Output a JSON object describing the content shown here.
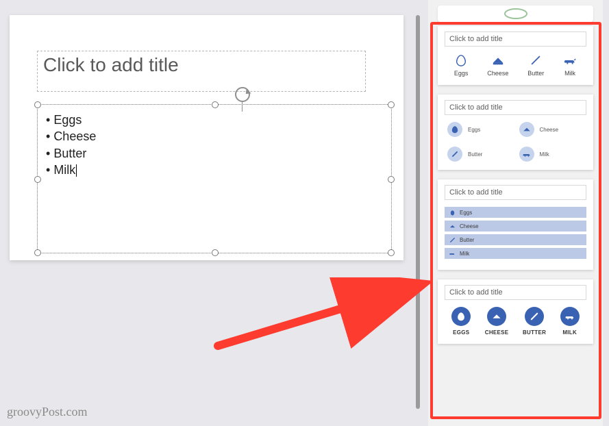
{
  "slide": {
    "title_placeholder": "Click to add title",
    "bullets": [
      "Eggs",
      "Cheese",
      "Butter",
      "Milk"
    ]
  },
  "watermark": "groovyPost.com",
  "design_ideas": {
    "title_placeholder": "Click to add title",
    "items": [
      {
        "label": "Eggs",
        "upper": "EGGS",
        "icon": "egg"
      },
      {
        "label": "Cheese",
        "upper": "CHEESE",
        "icon": "cheese"
      },
      {
        "label": "Butter",
        "upper": "BUTTER",
        "icon": "butter"
      },
      {
        "label": "Milk",
        "upper": "MILK",
        "icon": "cow"
      }
    ]
  },
  "colors": {
    "accent": "#3a62b3",
    "accent_light": "#bcc9e6",
    "highlight": "#fd3b2f"
  }
}
